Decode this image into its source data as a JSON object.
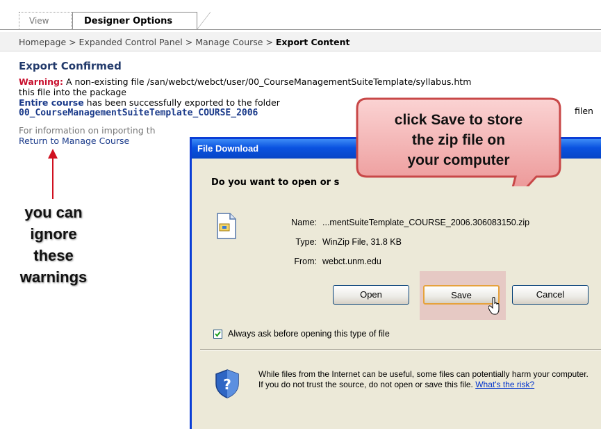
{
  "tabs": [
    {
      "label": "View"
    },
    {
      "label": "Designer Options"
    }
  ],
  "breadcrumb": {
    "path": "Homepage > Expanded Control Panel > Manage Course > ",
    "current": "Export Content"
  },
  "content": {
    "heading": "Export Confirmed",
    "warning_label": "Warning:",
    "warning_text": " A non-existing file /san/webct/webct/user/00_CourseManagementSuiteTemplate/syllabus.htm",
    "warning_text2": "this file into the package",
    "success_bold": "Entire course",
    "success_text": " has been successfully exported to the folder",
    "success_tail": "filen",
    "filename": "00_CourseManagementSuiteTemplate_COURSE_2006",
    "info_text": "For information on importing th",
    "return_link": "Return to Manage Course"
  },
  "annotations": {
    "ignore_note": [
      "you can",
      "ignore",
      "these",
      "warnings"
    ],
    "callout": [
      "click Save to store",
      "the zip file on",
      "your computer"
    ]
  },
  "dialog": {
    "title": "File Download",
    "question": "Do you want to open or s",
    "labels": {
      "name": "Name:",
      "type": "Type:",
      "from": "From:"
    },
    "values": {
      "name": "...mentSuiteTemplate_COURSE_2006.306083150.zip",
      "type": "WinZip File, 31.8 KB",
      "from": "webct.unm.edu"
    },
    "buttons": {
      "open": "Open",
      "save": "Save",
      "cancel": "Cancel"
    },
    "checkbox_label": "Always ask before opening this type of file",
    "warning": "While files from the Internet can be useful, some files can potentially harm your computer. If you do not trust the source, do not open or save this file. ",
    "risk_link": "What's the risk?"
  },
  "colors": {
    "title_bar": "#0a52e0",
    "warning_red": "#c8102e",
    "link_blue": "#1a3a8a",
    "callout_fill": "#f2a7a7"
  }
}
